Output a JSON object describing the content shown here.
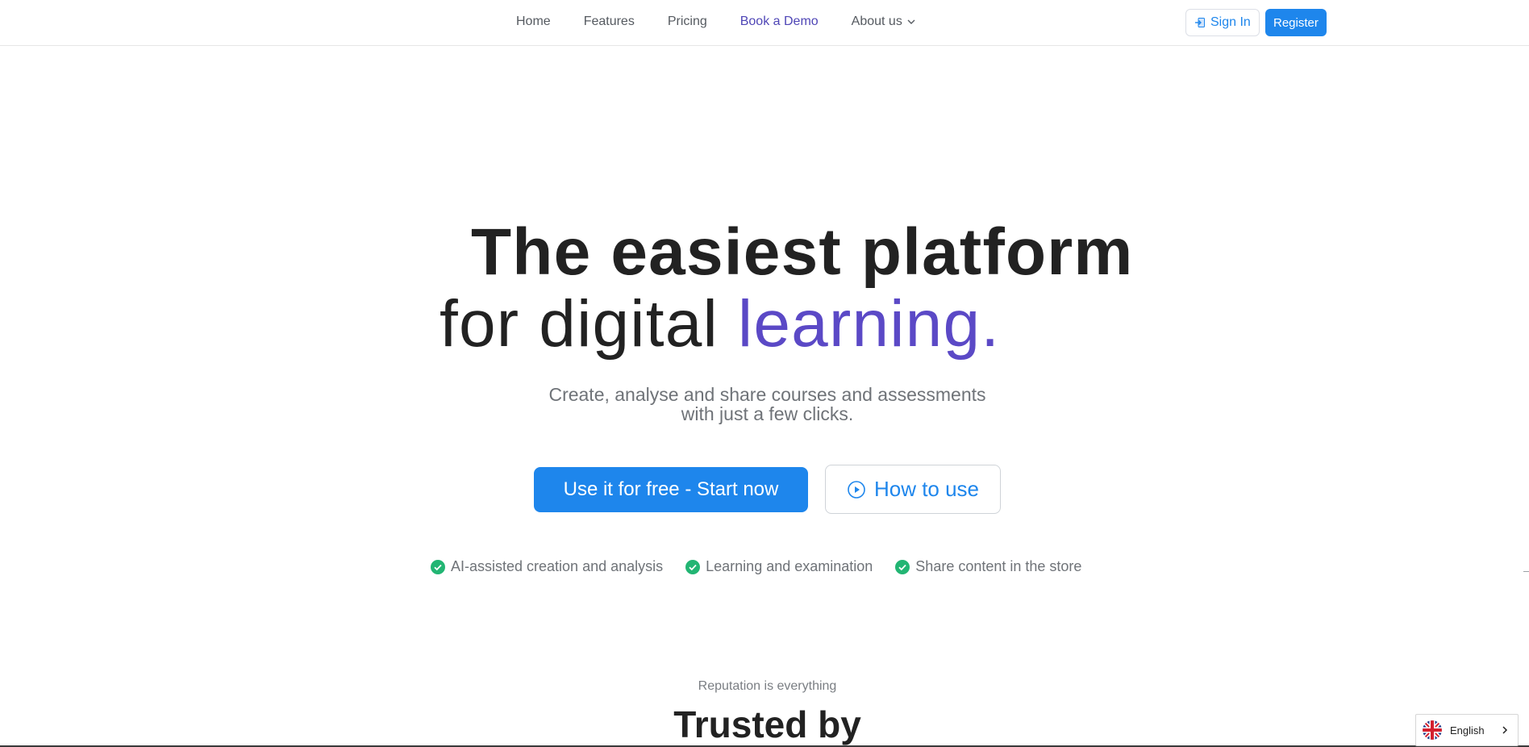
{
  "nav": {
    "links": [
      {
        "label": "Home"
      },
      {
        "label": "Features"
      },
      {
        "label": "Pricing"
      },
      {
        "label": "Book a Demo"
      },
      {
        "label": "About us"
      }
    ],
    "signin_label": "Sign In",
    "register_label": "Register"
  },
  "hero": {
    "line1": "The easiest platform",
    "line2_prefix": "for digital ",
    "line2_accent": "learning.",
    "subtitle_line1": "Create, analyse and share courses and assessments",
    "subtitle_line2": "with just a few clicks.",
    "cta_primary": "Use it for free - Start now",
    "cta_secondary": "How to use"
  },
  "features": [
    {
      "label": "AI-assisted creation and analysis"
    },
    {
      "label": "Learning and examination"
    },
    {
      "label": "Share content in the store"
    }
  ],
  "trust": {
    "caption": "Reputation is everything",
    "heading": "Trusted by"
  },
  "language": {
    "label": "English"
  },
  "colors": {
    "primary": "#1e86ec",
    "accent": "#5b49c6",
    "success": "#22b573"
  },
  "icons": {
    "about_chevron": "chevron-down-icon",
    "signin": "sign-in-icon",
    "howto": "play-circle-icon",
    "feature": "check-circle-icon",
    "flag": "uk-flag-icon",
    "lang_chevron": "chevron-right-icon"
  }
}
